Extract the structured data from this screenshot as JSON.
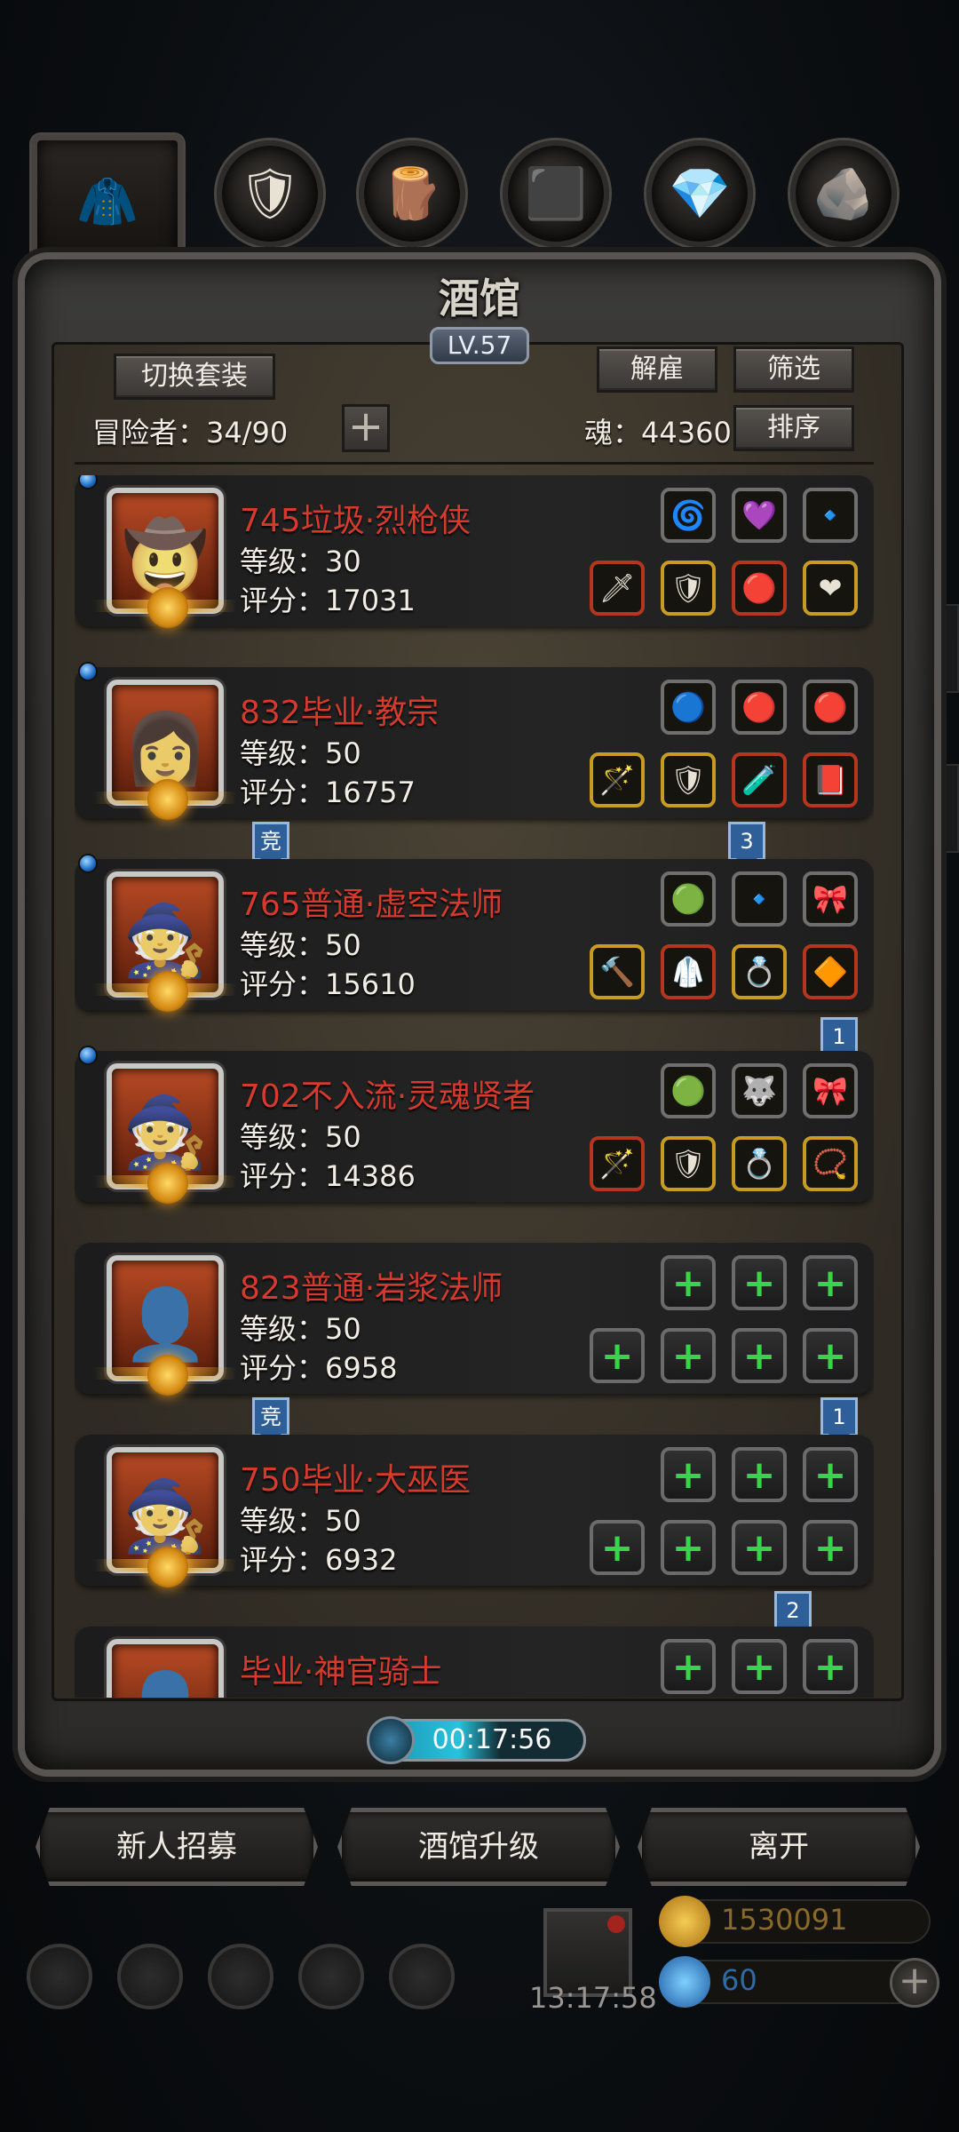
{
  "window": {
    "title": "酒馆",
    "level": "LV.57"
  },
  "toolbar": {
    "switch_outfit": "切换套装",
    "dismiss": "解雇",
    "filter": "筛选",
    "sort": "排序"
  },
  "stats": {
    "adventurers_label": "冒险者：34/90",
    "soul_label": "魂：44360"
  },
  "heroes": [
    {
      "name": "745垃圾·烈枪侠",
      "level": "等级：30",
      "score": "评分：17031",
      "face": "🤠"
    },
    {
      "name": "832毕业·教宗",
      "level": "等级：50",
      "score": "评分：16757",
      "face": "👩"
    },
    {
      "name": "765普通·虚空法师",
      "level": "等级：50",
      "score": "评分：15610",
      "face": "🧙"
    },
    {
      "name": "702不入流·灵魂贤者",
      "level": "等级：50",
      "score": "评分：14386",
      "face": "🧙"
    },
    {
      "name": "823普通·岩浆法师",
      "level": "等级：50",
      "score": "评分：6958",
      "face": "👤"
    },
    {
      "name": "750毕业·大巫医",
      "level": "等级：50",
      "score": "评分：6932",
      "face": "🧙"
    },
    {
      "name": "毕业·神官骑士",
      "level": "",
      "score": "",
      "face": "👤"
    }
  ],
  "tags": {
    "compete": "竞",
    "three": "3",
    "one": "1",
    "two": "2"
  },
  "timer": "00:17:56",
  "actions": {
    "recruit": "新人招募",
    "upgrade": "酒馆升级",
    "leave": "离开"
  },
  "bottom": {
    "gift_time": "13:17:58",
    "gold": "1530091",
    "gems": "60"
  },
  "colors": {
    "hero_name": "#d53a2c",
    "timer_fill": "#27c3dc",
    "tag_blue": "#2f5f99"
  }
}
